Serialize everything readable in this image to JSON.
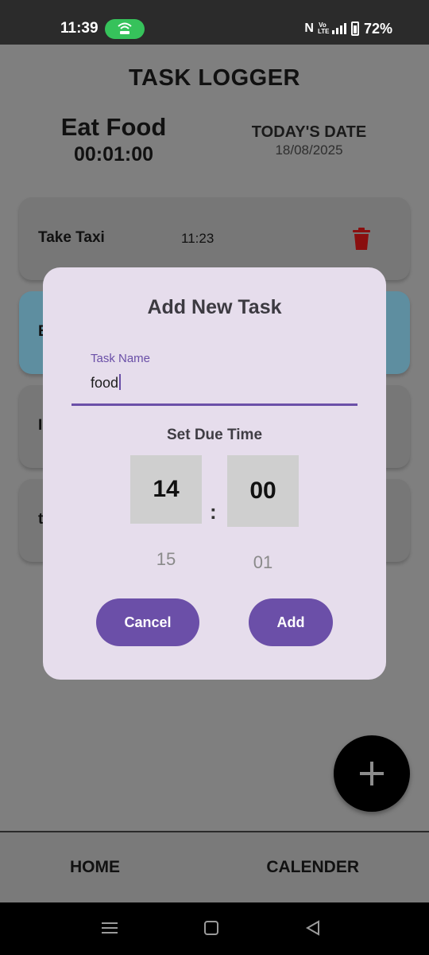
{
  "status_bar": {
    "time": "11:39",
    "battery": "72%",
    "hotspot_color": "#36c25b",
    "icons": [
      "hotspot-icon",
      "nfc-icon",
      "volte-icon",
      "signal-icon",
      "battery-icon"
    ]
  },
  "app": {
    "title": "TASK LOGGER",
    "current_task": {
      "name": "Eat Food",
      "timer": "00:01:00"
    },
    "today": {
      "label": "TODAY'S DATE",
      "date": "18/08/2025"
    },
    "tasks": [
      {
        "name": "Take Taxi",
        "time": "11:23",
        "icon": "trash-icon"
      },
      {
        "name": "E"
      },
      {
        "name": "I"
      },
      {
        "name": "t"
      }
    ],
    "fab_icon": "plus-icon"
  },
  "dialog": {
    "title": "Add New Task",
    "task_name_label": "Task Name",
    "task_name_value": "food",
    "due_time_label": "Set Due Time",
    "hour": "14",
    "minute": "00",
    "separator": ":",
    "next_hour": "15",
    "next_minute": "01",
    "cancel_label": "Cancel",
    "add_label": "Add",
    "accent_color": "#6b4fa8"
  },
  "bottom_nav": {
    "home": "HOME",
    "calendar": "CALENDER"
  }
}
